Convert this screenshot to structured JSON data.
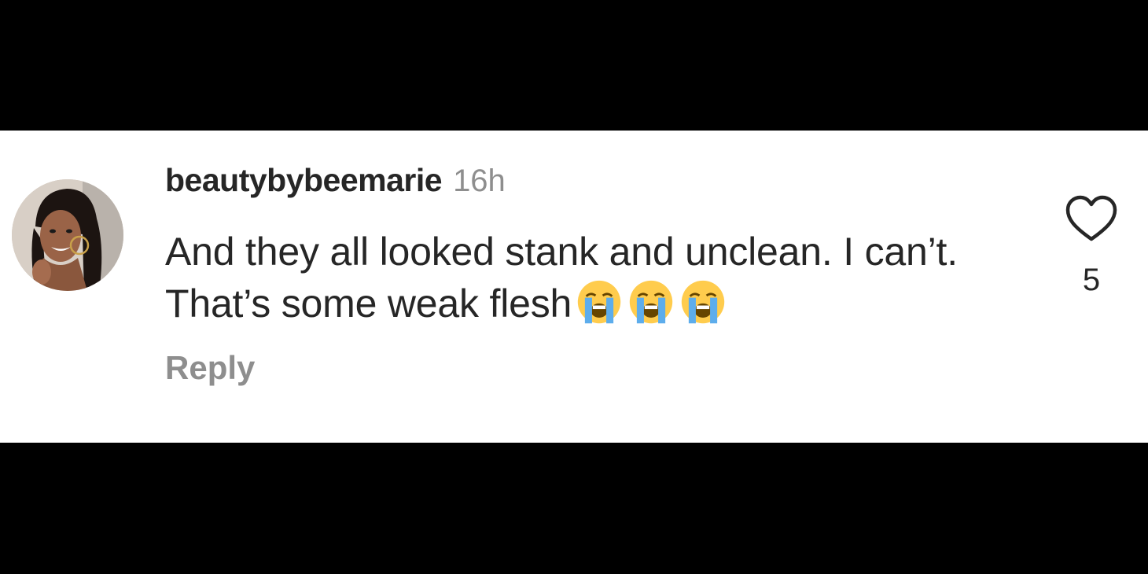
{
  "comment": {
    "username": "beautybybeemarie",
    "timestamp": "16h",
    "text": "And they all looked stank and unclean. I can’t. That’s some weak flesh",
    "emojis": [
      "loudly-crying-face",
      "loudly-crying-face",
      "loudly-crying-face"
    ],
    "reply_label": "Reply",
    "like_count": "5"
  },
  "colors": {
    "background_bars": "#000000",
    "card": "#ffffff",
    "primary_text": "#262626",
    "secondary_text": "#8e8e8e"
  },
  "icons": {
    "like": "heart-outline-icon",
    "avatar": "profile-photo"
  }
}
